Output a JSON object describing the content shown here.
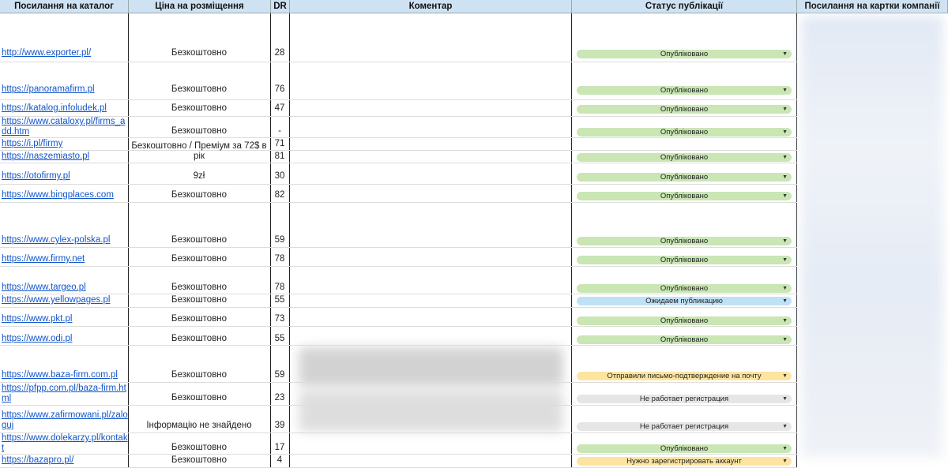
{
  "headers": {
    "catalog_link": "Посилання на каталог",
    "price": "Ціна на розміщення",
    "dr": "DR",
    "comment": "Коментар",
    "status": "Статус публікації",
    "company_card_link": "Посилання на картки компанії"
  },
  "rows": [
    {
      "link": "http://www.exporter.pl/",
      "price": "Безкоштовно",
      "dr": "28",
      "status": "Опубліковано"
    },
    {
      "link": "https://panoramafirm.pl",
      "price": "Безкоштовно",
      "dr": "76",
      "status": "Опубліковано"
    },
    {
      "link": "https://katalog.infoludek.pl",
      "price": "Безкоштовно",
      "dr": "47",
      "status": "Опубліковано"
    },
    {
      "link": "https://www.cataloxy.pl/firms_add.htm",
      "price": "Безкоштовно",
      "dr": "-",
      "status": "Опубліковано"
    },
    {
      "link": "https://i.pl/firmy",
      "price": "",
      "dr": "71",
      "status": ""
    },
    {
      "link": "https://naszemiasto.pl",
      "price": "Безкоштовно / Преміум за 72$ в рік",
      "dr": "81",
      "status": "Опубліковано"
    },
    {
      "link": "https://otofirmy.pl",
      "price": "9zł",
      "dr": "30",
      "status": "Опубліковано"
    },
    {
      "link": "https://www.bingplaces.com",
      "price": "Безкоштовно",
      "dr": "82",
      "status": "Опубліковано"
    },
    {
      "link": "https://www.cylex-polska.pl",
      "price": "Безкоштовно",
      "dr": "59",
      "status": "Опубліковано"
    },
    {
      "link": "https://www.firmy.net",
      "price": "Безкоштовно",
      "dr": "78",
      "status": "Опубліковано"
    },
    {
      "link": "https://www.targeo.pl",
      "price": "Безкоштовно",
      "dr": "78",
      "status": "Опубліковано"
    },
    {
      "link": "https://www.yellowpages.pl",
      "price": "Безкоштовно",
      "dr": "55",
      "status": "Ожидаем публикацию"
    },
    {
      "link": "https://www.pkt.pl",
      "price": "Безкоштовно",
      "dr": "73",
      "status": "Опубліковано"
    },
    {
      "link": "https://www.odi.pl",
      "price": "Безкоштовно",
      "dr": "55",
      "status": "Опубліковано"
    },
    {
      "link": "https://www.baza-firm.com.pl",
      "price": "Безкоштовно",
      "dr": "59",
      "status": "Отправили письмо-подтверждение на почту"
    },
    {
      "link": "https://pfpp.com.pl/baza-firm.html",
      "price": "Безкоштовно",
      "dr": "23",
      "status": "Не работает регистрация"
    },
    {
      "link": "https://www.zafirmowani.pl/zaloguj",
      "price": "Інформацію не знайдено",
      "dr": "39",
      "status": "Не работает регистрация"
    },
    {
      "link": "https://www.dolekarzy.pl/kontakt",
      "price": "Безкоштовно",
      "dr": "17",
      "status": "Опубліковано"
    },
    {
      "link": "https://bazapro.pl/",
      "price": "Безкоштовно",
      "dr": "4",
      "status": "Нужно зарегистрировать аккаунт"
    }
  ],
  "status_colors": {
    "Опубліковано": "#c9e6b4",
    "Ожидаем публикацию": "#bfe1f6",
    "Отправили письмо-подтверждение на почту": "#fde5a0",
    "Не работает регистрация": "#e6e6e6",
    "Нужно зарегистрировать аккаунт": "#fde5a0"
  }
}
